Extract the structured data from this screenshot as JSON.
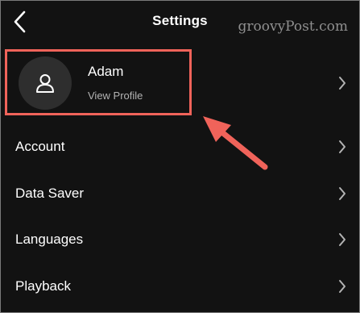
{
  "header": {
    "title": "Settings",
    "watermark": "groovyPost.com"
  },
  "icons": {
    "back": "chevron-left-icon",
    "avatar": "user-icon",
    "row_chevron": "chevron-right-icon"
  },
  "profile": {
    "name": "Adam",
    "subtitle": "View Profile"
  },
  "menu": {
    "items": [
      {
        "label": "Account"
      },
      {
        "label": "Data Saver"
      },
      {
        "label": "Languages"
      },
      {
        "label": "Playback"
      }
    ]
  },
  "colors": {
    "background": "#121212",
    "text_primary": "#ffffff",
    "text_secondary": "#b3b3b3",
    "annotation": "#f0635a"
  }
}
